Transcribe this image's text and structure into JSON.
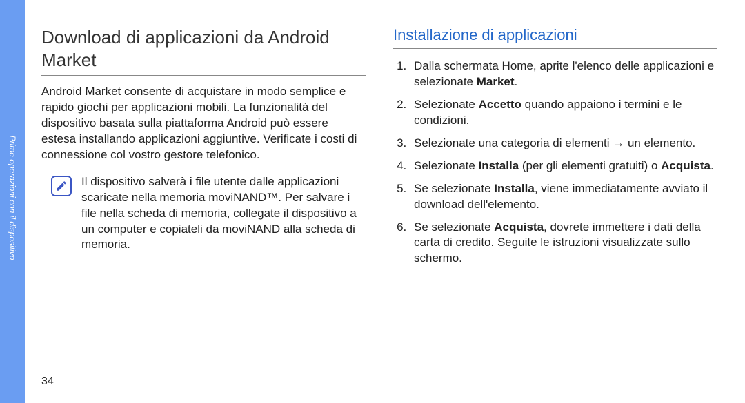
{
  "sidebar": {
    "label": "Prime operazioni con il dispositivo"
  },
  "page_number": "34",
  "left": {
    "title": "Download di applicazioni da Android Market",
    "paragraph": "Android Market consente di acquistare in modo semplice e rapido giochi per applicazioni mobili. La funzionalità del dispositivo basata sulla piattaforma Android può essere estesa installando applicazioni aggiuntive. Verificate i costi di connessione col vostro gestore telefonico.",
    "note_icon": "pencil-note-icon",
    "note": "Il dispositivo salverà i file utente dalle applicazioni scaricate nella memoria moviNAND™. Per salvare i file nella scheda di memoria, collegate il dispositivo a un computer e copiateli da moviNAND alla scheda di memoria."
  },
  "right": {
    "subtitle": "Installazione di applicazioni",
    "steps": [
      {
        "pre": "Dalla schermata Home, aprite l'elenco delle applicazioni e selezionate ",
        "bold1": "Market",
        "post": "."
      },
      {
        "pre": "Selezionate ",
        "bold1": "Accetto",
        "post": " quando appaiono i termini e le condizioni."
      },
      {
        "pre": "Selezionate una categoria di elementi → un elemento."
      },
      {
        "pre": "Selezionate ",
        "bold1": "Installa",
        "mid": " (per gli elementi gratuiti) o ",
        "bold2": "Acquista",
        "post": "."
      },
      {
        "pre": "Se selezionate ",
        "bold1": "Installa",
        "post": ", viene immediatamente avviato il download dell'elemento."
      },
      {
        "pre": "Se selezionate ",
        "bold1": "Acquista",
        "post": ", dovrete immettere i dati della carta di credito. Seguite le istruzioni visualizzate sullo schermo."
      }
    ]
  }
}
